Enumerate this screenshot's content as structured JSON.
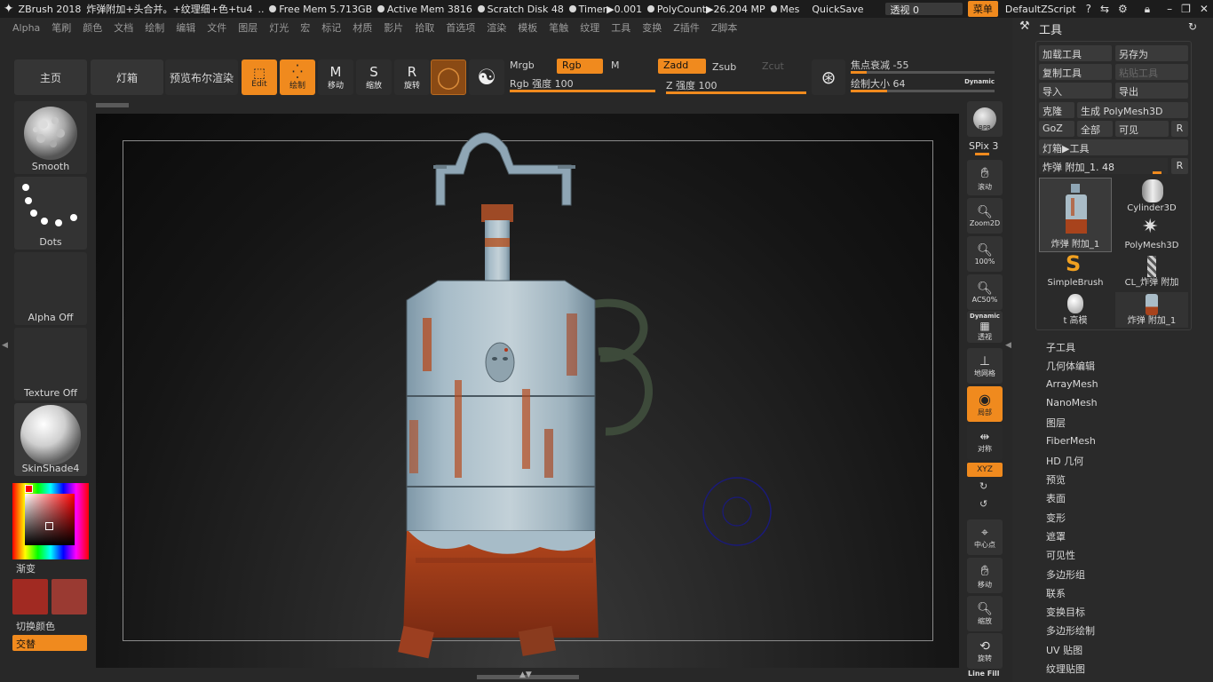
{
  "titlebar": {
    "app": "ZBrush 2018",
    "doc": "炸弹附加+头合并。+纹理细+色+tu4",
    "ellipsis": "..",
    "free_mem": "Free Mem 5.713GB",
    "active_mem": "Active Mem 3816",
    "scratch": "Scratch Disk 48",
    "timer": "Timer▶0.001",
    "polycount": "PolyCount▶26.204 MP",
    "mes": "Mes",
    "quicksave": "QuickSave",
    "perspective": "透视  0",
    "menu": "菜单",
    "script": "DefaultZScript"
  },
  "menubar": [
    "Alpha",
    "笔刷",
    "颜色",
    "文档",
    "绘制",
    "编辑",
    "文件",
    "图层",
    "灯光",
    "宏",
    "标记",
    "材质",
    "影片",
    "拾取",
    "首选项",
    "渲染",
    "模板",
    "笔触",
    "纹理",
    "工具",
    "变换",
    "Z插件",
    "Z脚本"
  ],
  "shelf": {
    "home": "主页",
    "lightbox": "灯箱",
    "bpr": "预览布尔渲染",
    "edit": "Edit",
    "draw": "绘制",
    "move": "移动",
    "scale": "缩放",
    "rotate": "旋转",
    "mrgb": "Mrgb",
    "rgb": "Rgb",
    "m": "M",
    "rgb_intensity": "Rgb 强度 100",
    "zadd": "Zadd",
    "zsub": "Zsub",
    "zcut": "Zcut",
    "z_intensity": "Z 强度 100",
    "focal_shift": "焦点衰减 -55",
    "draw_size": "绘制大小 64",
    "dynamic": "Dynamic",
    "rgb_intensity_value": 100,
    "z_intensity_value": 100,
    "focal_shift_value": -55,
    "draw_size_value": 64
  },
  "left_tray": {
    "brush": "Smooth",
    "stroke": "Dots",
    "alpha": "Alpha Off",
    "texture": "Texture Off",
    "material": "SkinShade4",
    "gradient": "渐变",
    "switch_color": "切换颜色",
    "alternate": "交替",
    "main_color": "#a12a22",
    "secondary_color": "#9a3a32"
  },
  "right_dock": {
    "bpr": "BPR",
    "spix": "SPix 3",
    "scroll": "滚动",
    "zoom2d": "Zoom2D",
    "hundred": "100%",
    "ac50": "AC50%",
    "dynamic": "Dynamic",
    "persp": "透视",
    "floor": "地网格",
    "polyf": "局部",
    "frame": "对称",
    "xyz": "XYZ",
    "center": "中心点",
    "move": "移动",
    "zoom": "缩放",
    "rotate": "旋转",
    "linefill": "Line Fill"
  },
  "tool_panel": {
    "title": "工具",
    "load_tool": "加载工具",
    "save_as": "另存为",
    "copy_tool": "复制工具",
    "paste_tool": "粘贴工具",
    "import": "导入",
    "export": "导出",
    "clone": "克隆",
    "make_polymesh": "生成 PolyMesh3D",
    "goz": "GoZ",
    "all": "全部",
    "visible": "可见",
    "r": "R",
    "lightbox_tools": "灯箱▶工具",
    "current_tool": "炸弹 附加_1. 48",
    "current_tool_level": 48,
    "thumbs": [
      "炸弹 附加_1",
      "Cylinder3D",
      "PolyMesh3D",
      "SimpleBrush",
      "CL_炸弹 附加",
      "t 高模",
      "炸弹 附加_1"
    ],
    "subpalettes": [
      "子工具",
      "几何体编辑",
      "ArrayMesh",
      "NanoMesh",
      "图层",
      "FiberMesh",
      "HD 几何",
      "预览",
      "表面",
      "变形",
      "遮罩",
      "可见性",
      "多边形组",
      "联系",
      "变换目标",
      "多边形绘制",
      "UV 贴图",
      "纹理贴图"
    ]
  }
}
